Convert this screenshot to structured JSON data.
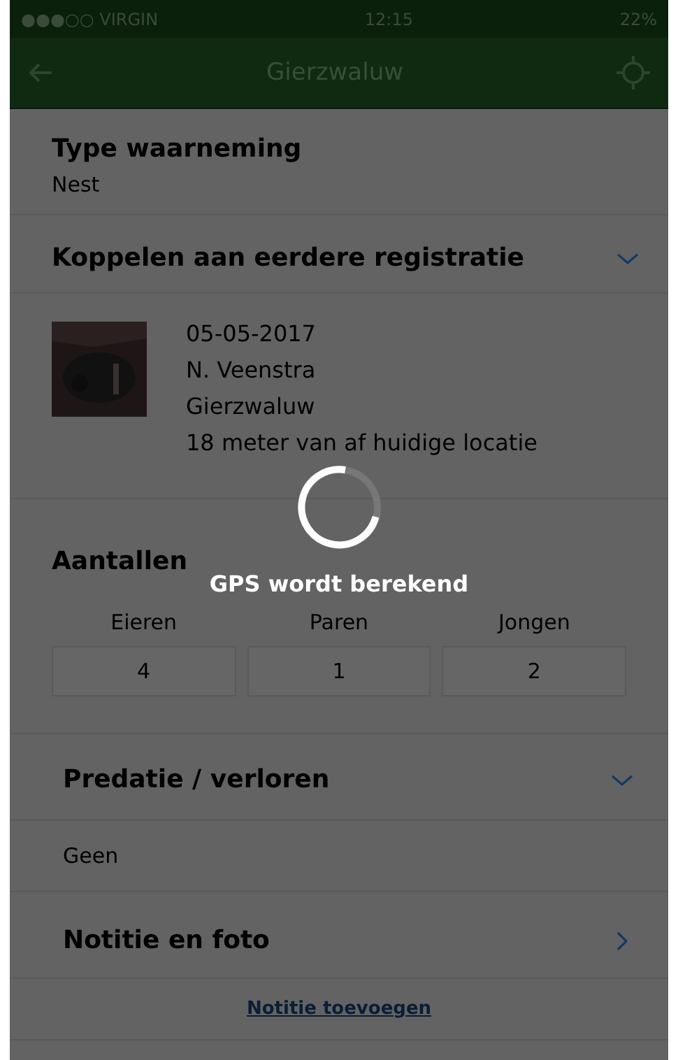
{
  "status_bar": {
    "carrier": "●●●○○ VIRGIN",
    "time": "12:15",
    "battery": "22%"
  },
  "nav": {
    "title": "Gierzwaluw"
  },
  "type": {
    "label": "Type waarneming",
    "value": "Nest"
  },
  "link_section": {
    "title": "Koppelen aan eerdere registratie",
    "expanded": true
  },
  "record": {
    "lines": [
      "05-05-2017",
      "N. Veenstra",
      "Gierzwaluw",
      "18 meter van af huidige locatie"
    ]
  },
  "counts": {
    "title": "Aantallen",
    "fields": [
      {
        "label": "Eieren",
        "value": "4"
      },
      {
        "label": "Paren",
        "value": "1"
      },
      {
        "label": "Jongen",
        "value": "2"
      }
    ]
  },
  "predation": {
    "title": "Predatie / verloren",
    "expanded": true,
    "value": "Geen"
  },
  "notes": {
    "title": "Notitie en foto",
    "expanded": false,
    "link": "Notitie toevoegen"
  },
  "loading": {
    "message": "GPS wordt berekend"
  }
}
